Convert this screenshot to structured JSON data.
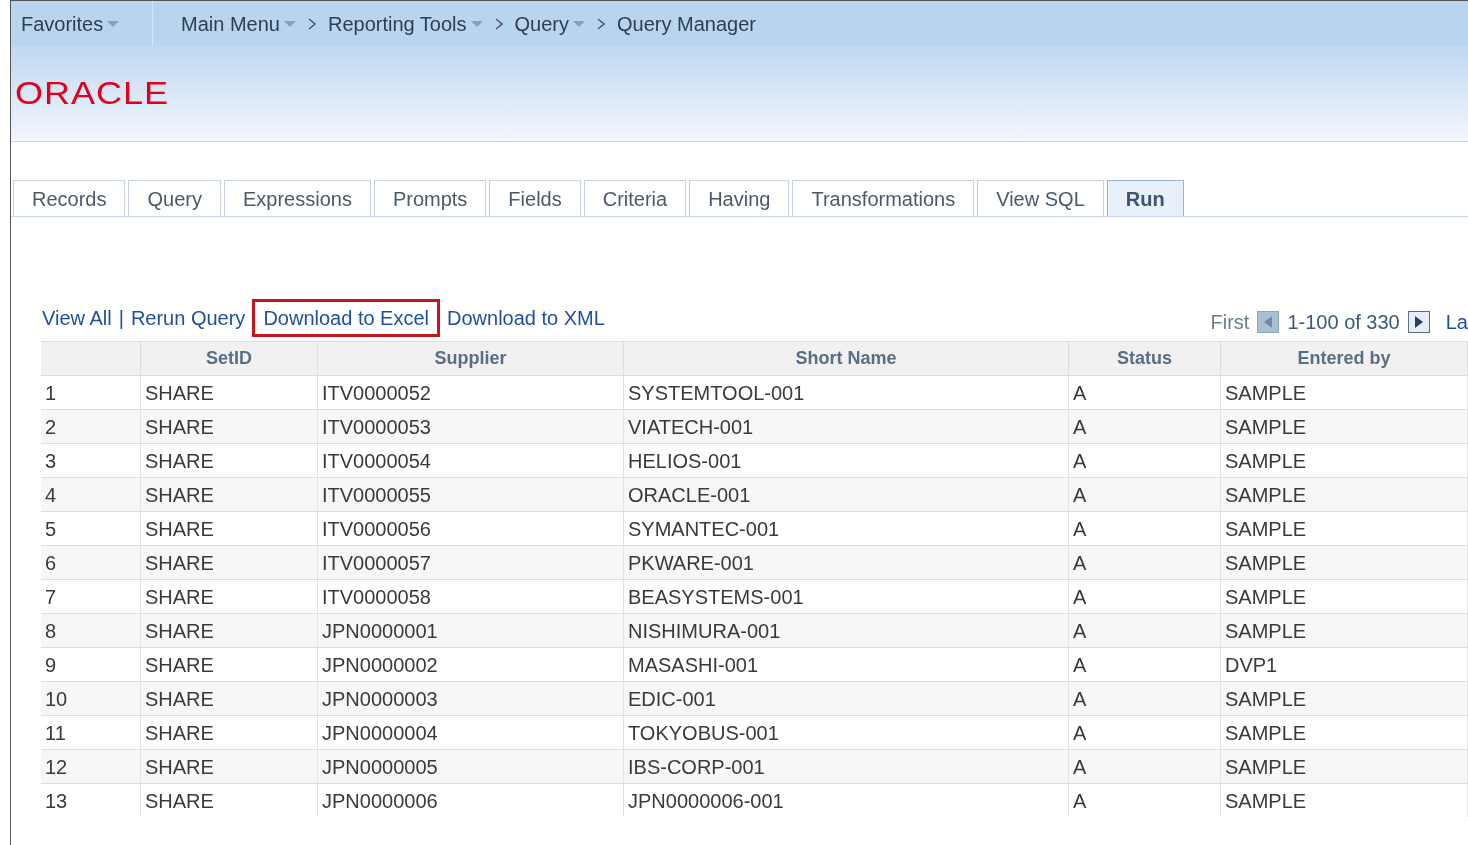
{
  "nav": {
    "favorites": "Favorites",
    "breadcrumbs": [
      {
        "label": "Main Menu",
        "dropdown": true
      },
      {
        "label": "Reporting Tools",
        "dropdown": true
      },
      {
        "label": "Query",
        "dropdown": true
      },
      {
        "label": "Query Manager",
        "dropdown": false
      }
    ]
  },
  "logo": "ORACLE",
  "tabs": [
    {
      "label": "Records",
      "selected": false
    },
    {
      "label": "Query",
      "selected": false
    },
    {
      "label": "Expressions",
      "selected": false
    },
    {
      "label": "Prompts",
      "selected": false
    },
    {
      "label": "Fields",
      "selected": false
    },
    {
      "label": "Criteria",
      "selected": false
    },
    {
      "label": "Having",
      "selected": false
    },
    {
      "label": "Transformations",
      "selected": false
    },
    {
      "label": "View SQL",
      "selected": false
    },
    {
      "label": "Run",
      "selected": true
    }
  ],
  "actions": [
    {
      "label": "View All",
      "highlighted": false
    },
    {
      "label": "Rerun Query",
      "highlighted": false
    },
    {
      "label": "Download to Excel",
      "highlighted": true
    },
    {
      "label": "Download to XML",
      "highlighted": false
    }
  ],
  "action_separator": "|",
  "pager": {
    "first": "First",
    "range": "1-100 of 330",
    "last": "La"
  },
  "table": {
    "columns": [
      "",
      "SetID",
      "Supplier",
      "Short Name",
      "Status",
      "Entered by"
    ],
    "rows": [
      [
        "1",
        "SHARE",
        "ITV0000052",
        "SYSTEMTOOL-001",
        "A",
        "SAMPLE"
      ],
      [
        "2",
        "SHARE",
        "ITV0000053",
        "VIATECH-001",
        "A",
        "SAMPLE"
      ],
      [
        "3",
        "SHARE",
        "ITV0000054",
        "HELIOS-001",
        "A",
        "SAMPLE"
      ],
      [
        "4",
        "SHARE",
        "ITV0000055",
        "ORACLE-001",
        "A",
        "SAMPLE"
      ],
      [
        "5",
        "SHARE",
        "ITV0000056",
        "SYMANTEC-001",
        "A",
        "SAMPLE"
      ],
      [
        "6",
        "SHARE",
        "ITV0000057",
        "PKWARE-001",
        "A",
        "SAMPLE"
      ],
      [
        "7",
        "SHARE",
        "ITV0000058",
        "BEASYSTEMS-001",
        "A",
        "SAMPLE"
      ],
      [
        "8",
        "SHARE",
        "JPN0000001",
        "NISHIMURA-001",
        "A",
        "SAMPLE"
      ],
      [
        "9",
        "SHARE",
        "JPN0000002",
        "MASASHI-001",
        "A",
        "DVP1"
      ],
      [
        "10",
        "SHARE",
        "JPN0000003",
        "EDIC-001",
        "A",
        "SAMPLE"
      ],
      [
        "11",
        "SHARE",
        "JPN0000004",
        "TOKYOBUS-001",
        "A",
        "SAMPLE"
      ],
      [
        "12",
        "SHARE",
        "JPN0000005",
        "IBS-CORP-001",
        "A",
        "SAMPLE"
      ],
      [
        "13",
        "SHARE",
        "JPN0000006",
        "JPN0000006-001",
        "A",
        "SAMPLE"
      ]
    ]
  }
}
